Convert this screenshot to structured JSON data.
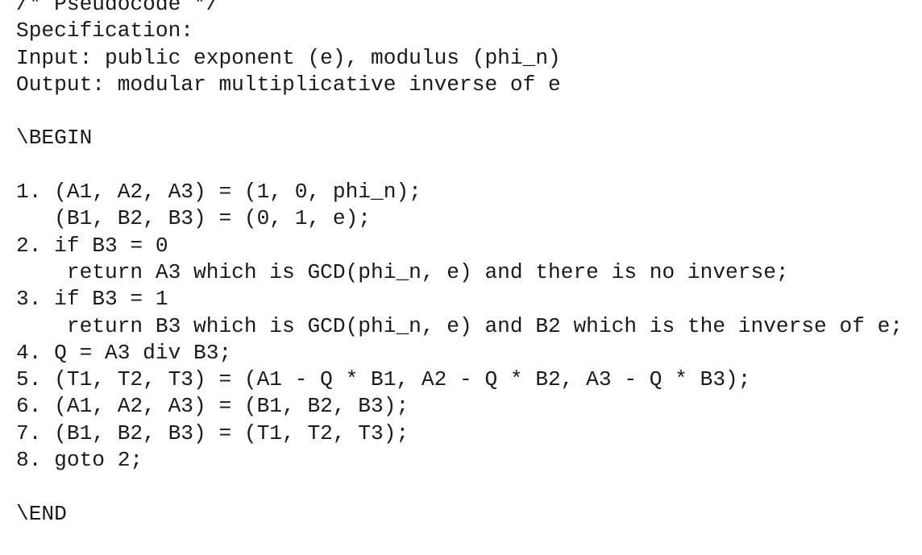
{
  "document": {
    "lines": [
      "/* Pseudocode */",
      "Specification:",
      "Input: public exponent (e), modulus (phi_n)",
      "Output: modular multiplicative inverse of e",
      "",
      "\\BEGIN",
      "",
      "1. (A1, A2, A3) = (1, 0, phi_n);",
      "   (B1, B2, B3) = (0, 1, e);",
      "2. if B3 = 0",
      "    return A3 which is GCD(phi_n, e) and there is no inverse;",
      "3. if B3 = 1",
      "    return B3 which is GCD(phi_n, e) and B2 which is the inverse of e;",
      "4. Q = A3 div B3;",
      "5. (T1, T2, T3) = (A1 - Q * B1, A2 - Q * B2, A3 - Q * B3);",
      "6. (A1, A2, A3) = (B1, B2, B3);",
      "7. (B1, B2, B3) = (T1, T2, T3);",
      "8. goto 2;",
      "",
      "\\END"
    ]
  }
}
